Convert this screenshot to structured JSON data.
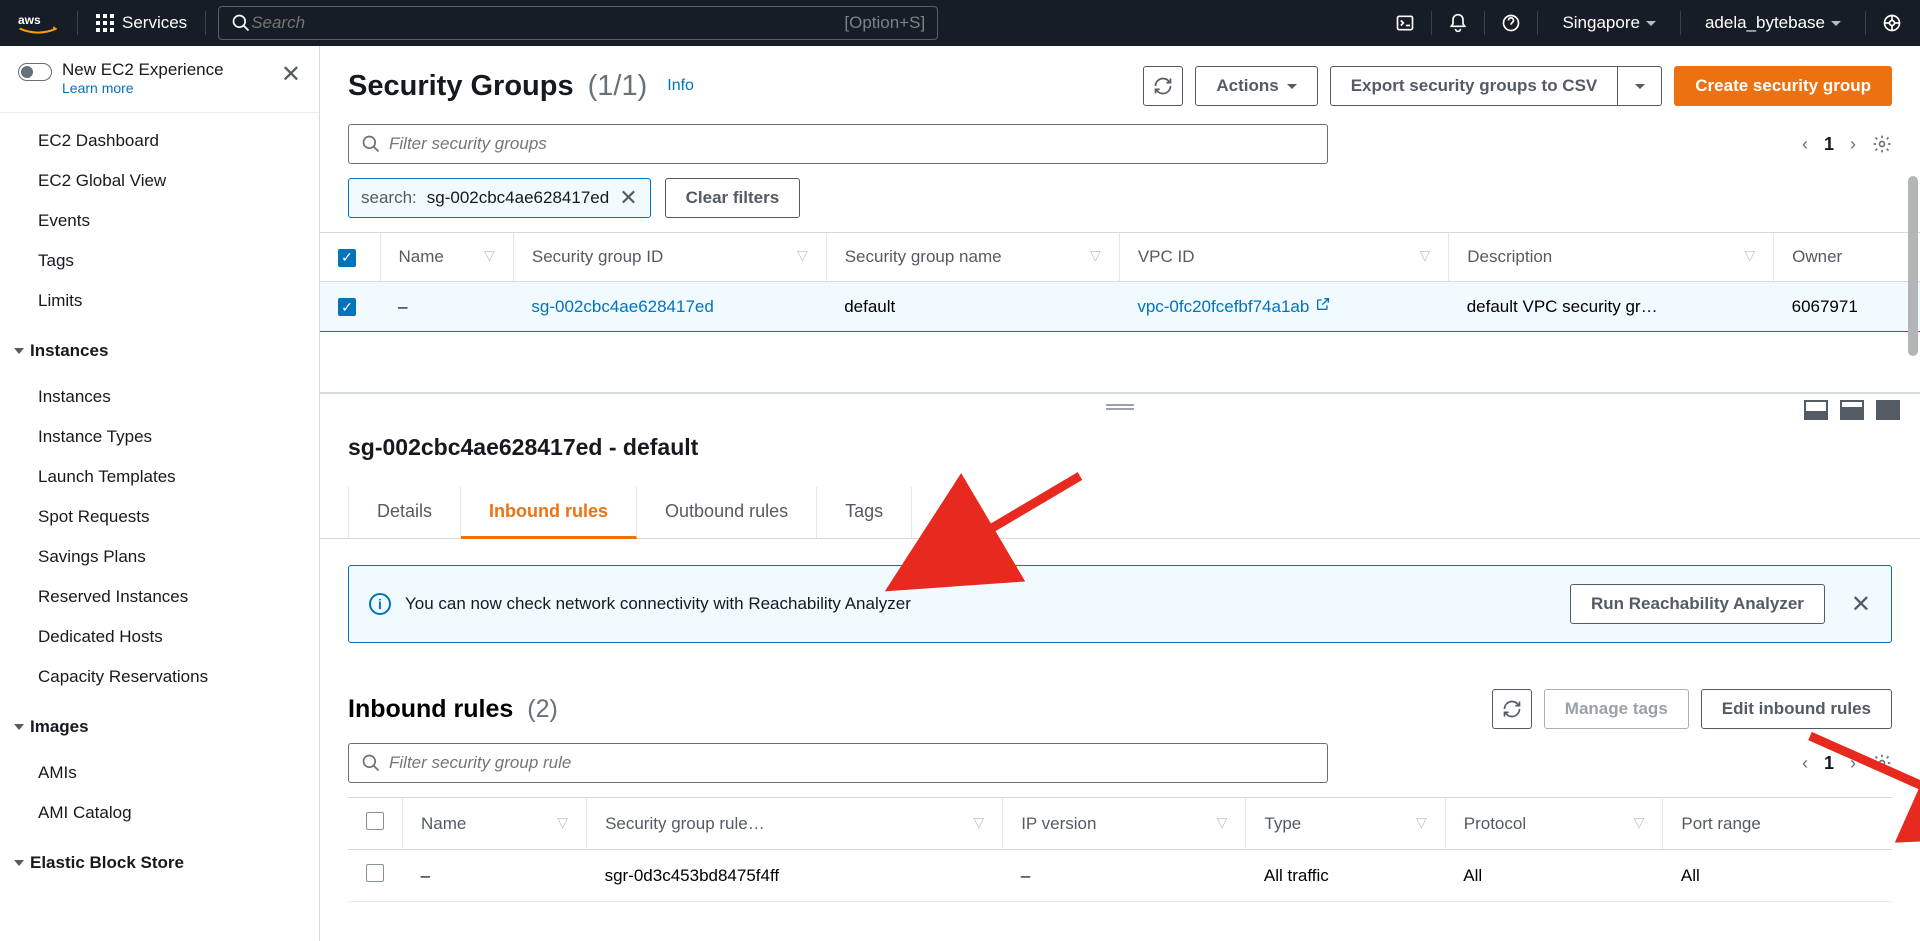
{
  "topnav": {
    "services": "Services",
    "search_placeholder": "Search",
    "shortcut": "[Option+S]",
    "region": "Singapore",
    "user": "adela_bytebase"
  },
  "sidebar": {
    "experience": {
      "title": "New EC2 Experience",
      "learn": "Learn more"
    },
    "top": [
      "EC2 Dashboard",
      "EC2 Global View",
      "Events",
      "Tags",
      "Limits"
    ],
    "instances_header": "Instances",
    "instances": [
      "Instances",
      "Instance Types",
      "Launch Templates",
      "Spot Requests",
      "Savings Plans",
      "Reserved Instances",
      "Dedicated Hosts",
      "Capacity Reservations"
    ],
    "images_header": "Images",
    "images": [
      "AMIs",
      "AMI Catalog"
    ],
    "ebs_header": "Elastic Block Store"
  },
  "header": {
    "title": "Security Groups",
    "count": "(1/1)",
    "info": "Info",
    "actions": "Actions",
    "export": "Export security groups to CSV",
    "create": "Create security group"
  },
  "filter": {
    "placeholder": "Filter security groups",
    "chip_key": "search:",
    "chip_val": "sg-002cbc4ae628417ed",
    "clear": "Clear filters",
    "page": "1"
  },
  "table": {
    "cols": [
      "Name",
      "Security group ID",
      "Security group name",
      "VPC ID",
      "Description",
      "Owner"
    ],
    "row": {
      "name": "–",
      "sgid": "sg-002cbc4ae628417ed",
      "sgname": "default",
      "vpc": "vpc-0fc20fcefbf74a1ab",
      "desc": "default VPC security gr…",
      "owner": "6067971"
    }
  },
  "detail": {
    "title": "sg-002cbc4ae628417ed - default",
    "tabs": [
      "Details",
      "Inbound rules",
      "Outbound rules",
      "Tags"
    ],
    "info_text": "You can now check network connectivity with Reachability Analyzer",
    "run_btn": "Run Reachability Analyzer",
    "rules_title": "Inbound rules",
    "rules_count": "(2)",
    "manage_tags": "Manage tags",
    "edit_rules": "Edit inbound rules",
    "rules_filter_placeholder": "Filter security group rule",
    "rules_page": "1",
    "rule_cols": [
      "Name",
      "Security group rule…",
      "IP version",
      "Type",
      "Protocol",
      "Port range"
    ],
    "rule_row": {
      "name": "–",
      "rid": "sgr-0d3c453bd8475f4ff",
      "ipv": "–",
      "type": "All traffic",
      "proto": "All",
      "range": "All"
    }
  }
}
